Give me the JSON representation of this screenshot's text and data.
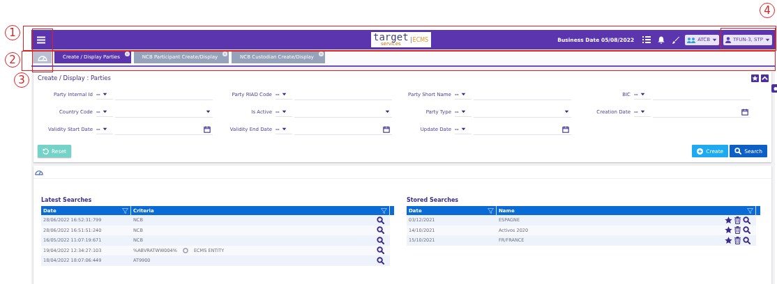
{
  "header": {
    "logo": {
      "word": "target",
      "sub": "services",
      "product": "ECMS"
    },
    "business_date": "Business Date 05/08/2022",
    "selectors": [
      {
        "kind": "group",
        "label": "ATCB"
      },
      {
        "kind": "user",
        "label": "TFUN-3, STP"
      }
    ]
  },
  "tabs": [
    {
      "label": "Create / Display Parties",
      "selected": true
    },
    {
      "label": "NCB Participant Create/Display",
      "selected": false
    },
    {
      "label": "NCB Custodian Create/Display",
      "selected": false
    }
  ],
  "page_title": "Create / Display : Parties",
  "filters": [
    {
      "label": "Party Internal Id",
      "operator": "--",
      "kind": "text"
    },
    {
      "label": "Party RIAD Code",
      "operator": "--",
      "kind": "text"
    },
    {
      "label": "Party Short Name",
      "operator": "--",
      "kind": "text"
    },
    {
      "label": "BIC",
      "operator": "--",
      "kind": "text"
    },
    {
      "label": "Country Code",
      "operator": "--",
      "kind": "select"
    },
    {
      "label": "Is Active",
      "operator": "--",
      "kind": "select"
    },
    {
      "label": "Party Type",
      "operator": "--",
      "kind": "select"
    },
    {
      "label": "Creation Date",
      "operator": "--",
      "kind": "date"
    },
    {
      "label": "Validity Start Date",
      "operator": "--",
      "kind": "date"
    },
    {
      "label": "Validity End Date",
      "operator": "--",
      "kind": "date"
    },
    {
      "label": "Update Date",
      "operator": "--",
      "kind": "date"
    }
  ],
  "buttons": {
    "reset": "Reset",
    "create": "Create",
    "search": "Search"
  },
  "latest_searches": {
    "title": "Latest Searches",
    "columns": [
      "Date",
      "Criteria"
    ],
    "rows": [
      {
        "date": "28/06/2022 16:52:31:799",
        "criteria": [
          "NCB"
        ]
      },
      {
        "date": "28/06/2022 16:51:51:240",
        "criteria": [
          "NCB"
        ]
      },
      {
        "date": "16/05/2022 11:07:19:671",
        "criteria": [
          "NCB"
        ]
      },
      {
        "date": "19/04/2022 12:34:27:103",
        "criteria": [
          "%ABVRATWW004%",
          "ECMS ENTITY"
        ]
      },
      {
        "date": "18/04/2022 18:07:06:449",
        "criteria": [
          "AT9900"
        ]
      }
    ]
  },
  "stored_searches": {
    "title": "Stored Searches",
    "columns": [
      "Date",
      "Name"
    ],
    "rows": [
      {
        "date": "03/12/2021",
        "name": "ESPAGNE"
      },
      {
        "date": "14/10/2021",
        "name": "Activos 2020"
      },
      {
        "date": "15/10/2021",
        "name": "FR/FRANCE"
      }
    ]
  },
  "callouts": [
    {
      "number": "1"
    },
    {
      "number": "2"
    },
    {
      "number": "3"
    },
    {
      "number": "4"
    }
  ]
}
